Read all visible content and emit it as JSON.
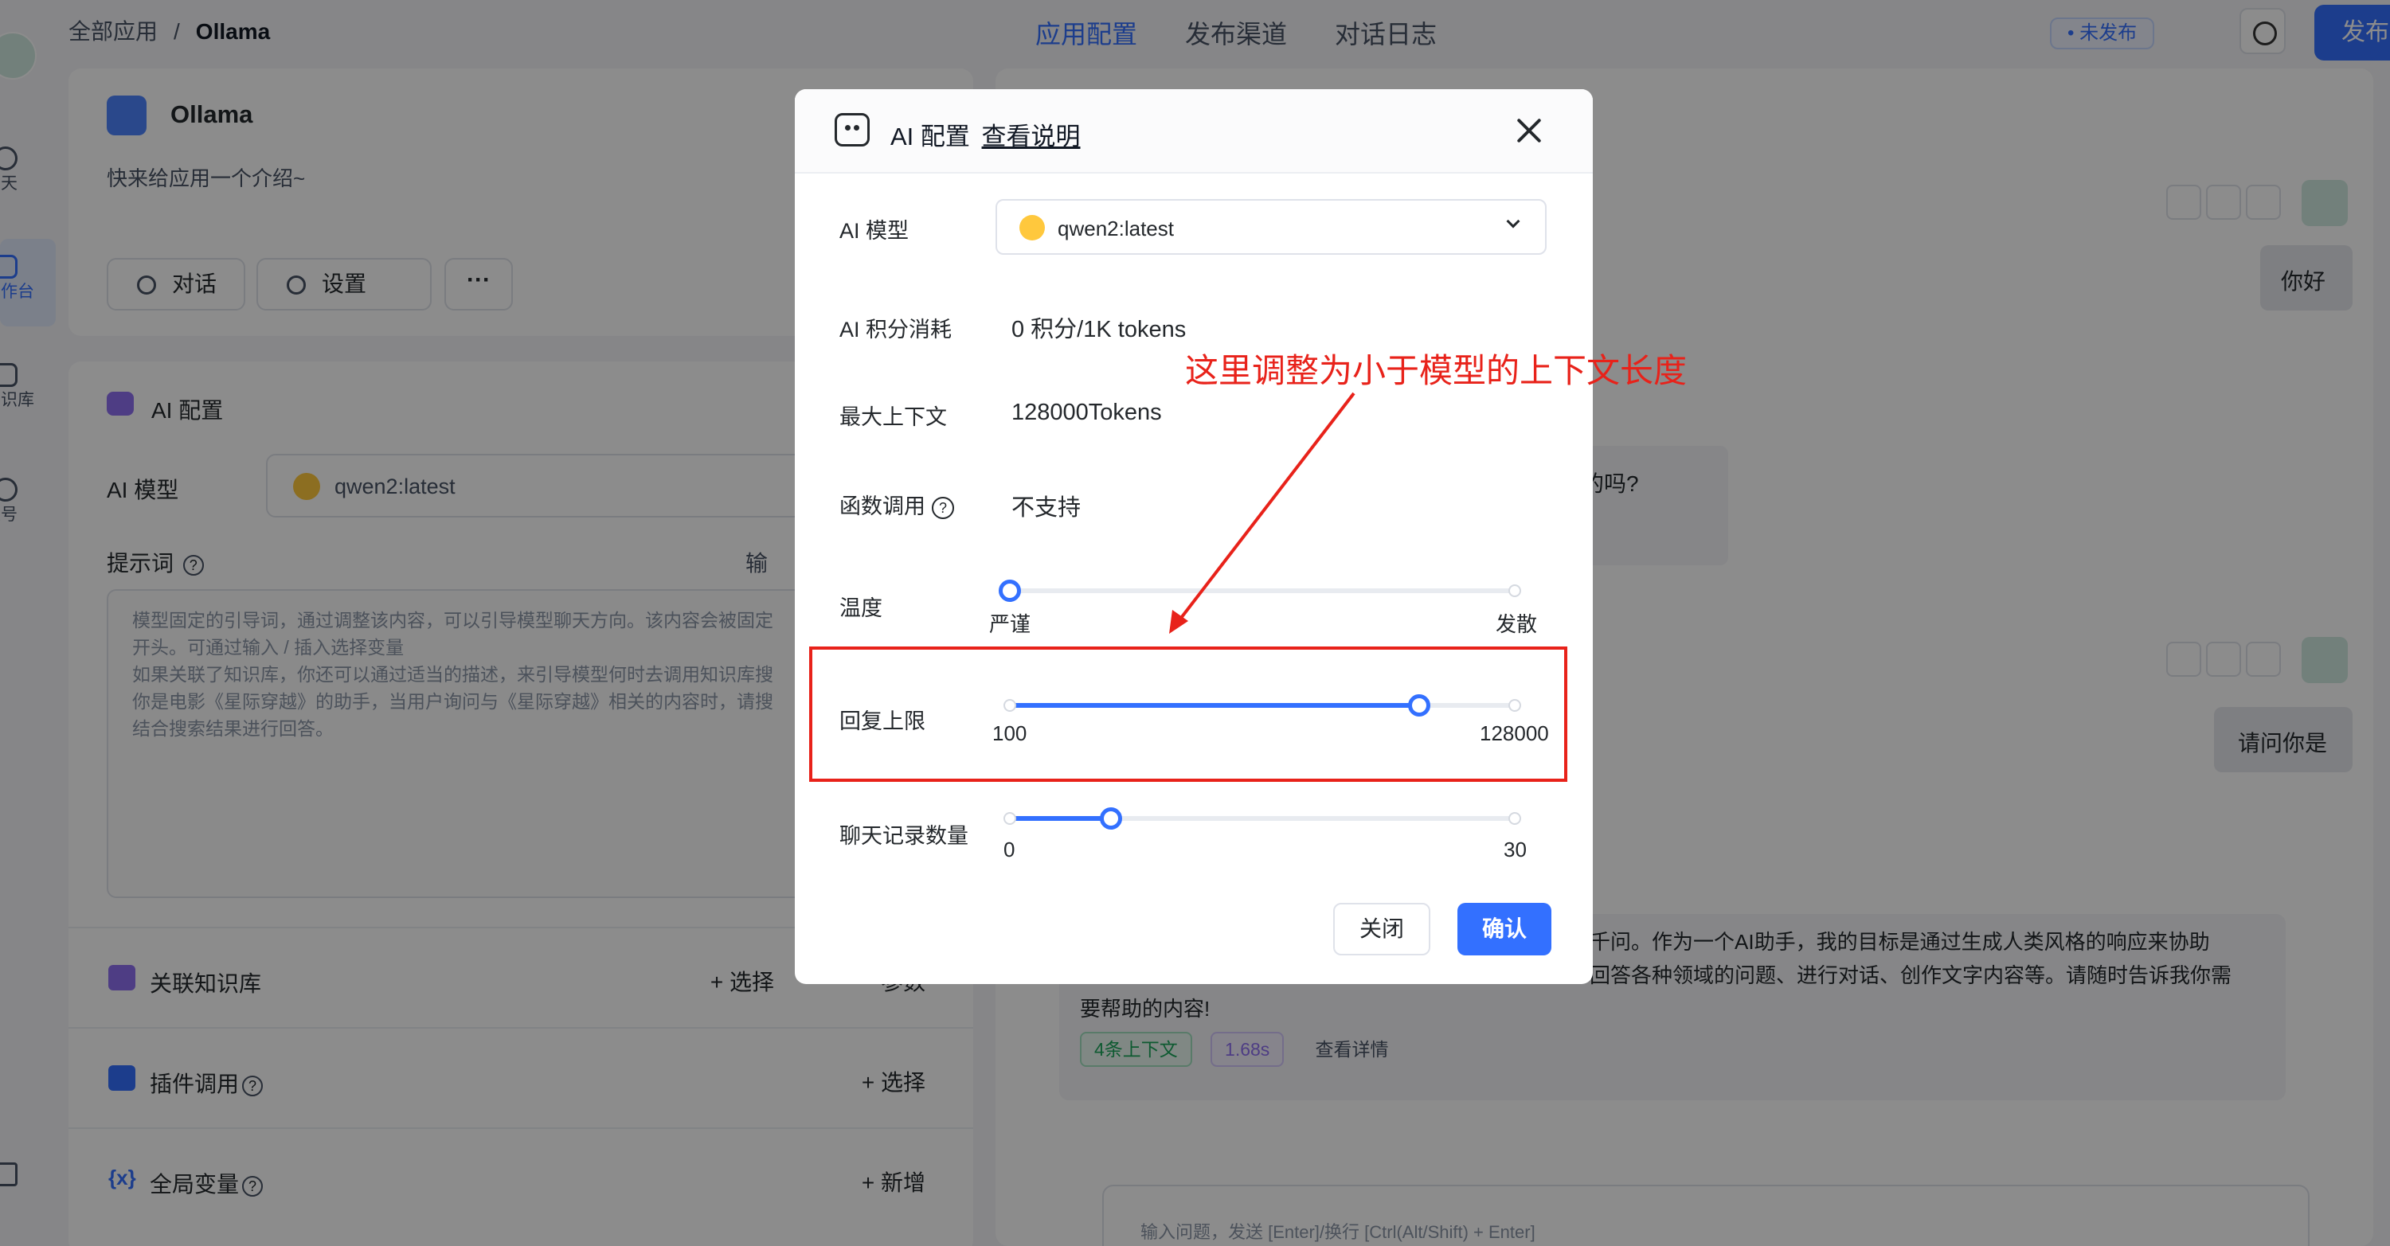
{
  "breadcrumb": {
    "root": "全部应用",
    "separator": "/",
    "current": "Ollama"
  },
  "top_tabs": [
    "应用配置",
    "发布渠道",
    "对话日志"
  ],
  "active_tab": "应用配置",
  "status_badge": "• 未发布",
  "publish_label": "发布",
  "rail": {
    "chat": "聊天",
    "workbench": "工作台",
    "knowledge": "知识库",
    "account": "账号"
  },
  "app": {
    "name": "Ollama",
    "intro": "快来给应用一个介绍~",
    "chat_button": "对话",
    "settings_button": "设置",
    "more": "···"
  },
  "config": {
    "title": "AI 配置",
    "model_label": "AI 模型",
    "model_value": "qwen2:latest",
    "prompt_label": "提示词",
    "prompt_extra": "输",
    "prompt_placeholder": [
      "模型固定的引导词，通过调整该内容，可以引导模型聊天方向。该内容会被固定",
      "开头。可通过输入 / 插入选择变量",
      "如果关联了知识库，你还可以通过适当的描述，来引导模型何时去调用知识库搜",
      "你是电影《星际穿越》的助手，当用户询问与《星际穿越》相关的内容时，请搜",
      "结合搜索结果进行回答。"
    ]
  },
  "sections": [
    {
      "title": "关联知识库",
      "action": "+ 选择",
      "extra": "参数",
      "color": "#8e6ff0"
    },
    {
      "title": "插件调用",
      "action": "+ 选择",
      "color": "#3370ff"
    },
    {
      "title": "全局变量",
      "action": "+ 新增",
      "color": "#3370ff"
    }
  ],
  "chat": {
    "user_messages": [
      "你好",
      "请问你是"
    ],
    "partial_question": "解答的吗?",
    "answer_lines": [
      "千问。作为一个AI助手，我的目标是通过生成人类风格的响应来协助",
      "回答各种领域的问题、进行对话、创作文字内容等。请随时告诉我你需",
      "要帮助的内容!"
    ],
    "tags": [
      "4条上下文",
      "1.68s",
      "查看详情"
    ],
    "input_placeholder": "输入问题，发送 [Enter]/换行 [Ctrl(Alt/Shift) + Enter]"
  },
  "modal": {
    "title": "AI 配置",
    "help_link": "查看说明",
    "model_label": "AI 模型",
    "model_value": "qwen2:latest",
    "cost_label": "AI 积分消耗",
    "cost_value": "0 积分/1K tokens",
    "max_context_label": "最大上下文",
    "max_context_value": "128000Tokens",
    "function_call_label": "函数调用",
    "function_call_value": "不支持",
    "temperature": {
      "label": "温度",
      "min_label": "严谨",
      "max_label": "发散",
      "value_fraction": 0.0
    },
    "max_reply": {
      "label": "回复上限",
      "min": 100,
      "max": 128000,
      "value_fraction": 0.81
    },
    "history": {
      "label": "聊天记录数量",
      "min": 0,
      "max": 30,
      "value": 6
    },
    "close_button": "关闭",
    "confirm_button": "确认"
  },
  "annotation": {
    "text": "这里调整为小于模型的上下文长度",
    "color": "#e8221a"
  }
}
